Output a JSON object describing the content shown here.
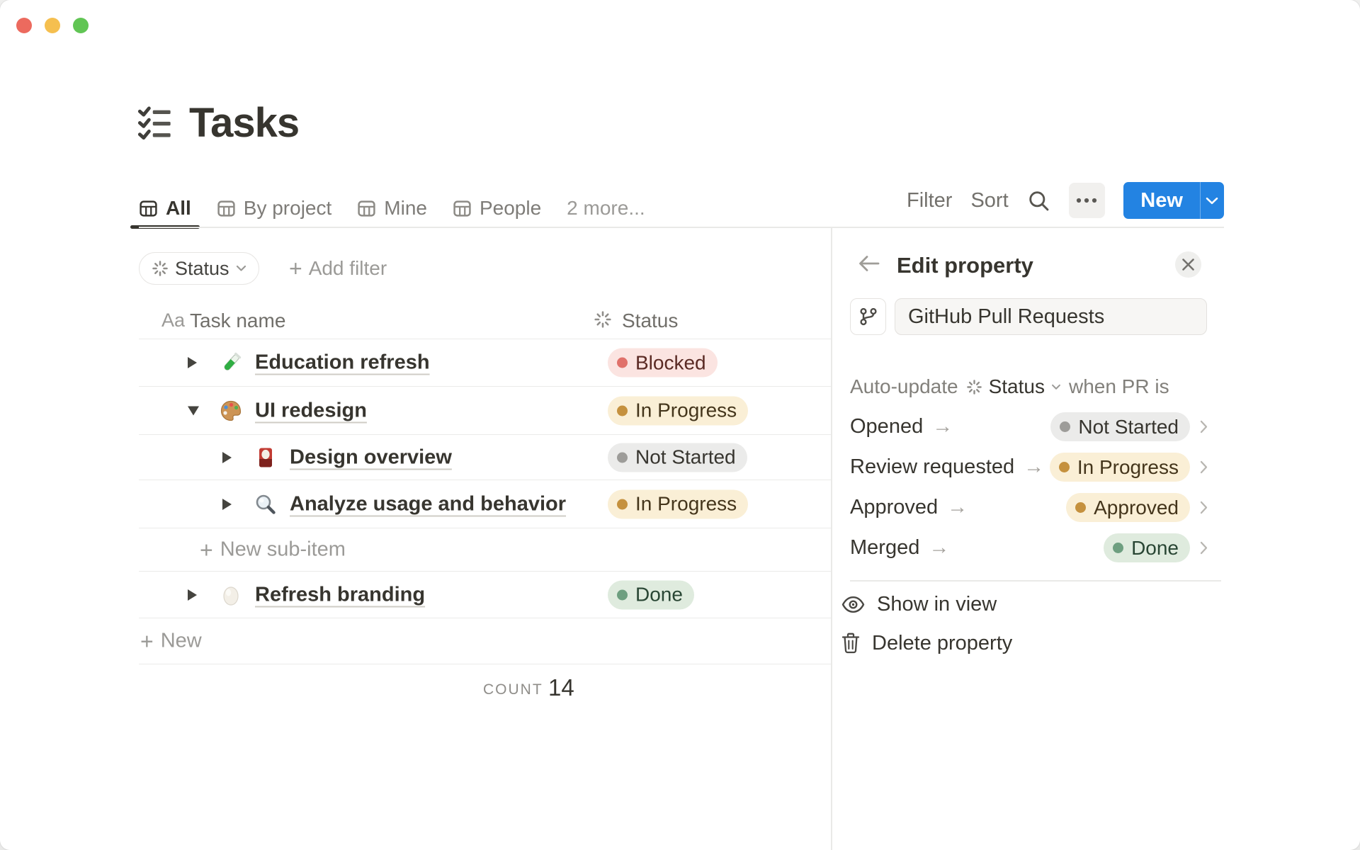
{
  "window": {
    "traffic_lights": {
      "close": "#EC6A5E",
      "minimize": "#F5BF4F",
      "zoom": "#61C554"
    }
  },
  "page": {
    "title": "Tasks"
  },
  "tabs": {
    "items": [
      {
        "label": "All"
      },
      {
        "label": "By project"
      },
      {
        "label": "Mine"
      },
      {
        "label": "People"
      }
    ],
    "active": "All",
    "more_label": "2 more..."
  },
  "toolbar": {
    "filter": "Filter",
    "sort": "Sort",
    "new_label": "New"
  },
  "filter_bar": {
    "status_filter": "Status",
    "add_filter": "Add filter"
  },
  "table": {
    "header": {
      "name_icon": "Aa",
      "name": "Task name",
      "status": "Status"
    },
    "rows": [
      {
        "name": "Education refresh",
        "status": "Blocked",
        "emoji": "test-tube",
        "level": 0,
        "state": "collapsed"
      },
      {
        "name": "UI redesign",
        "status": "In Progress",
        "emoji": "palette",
        "level": 0,
        "state": "expanded"
      },
      {
        "name": "Design overview",
        "status": "Not Started",
        "emoji": "flower-card",
        "level": 1,
        "state": "collapsed"
      },
      {
        "name": "Analyze usage and behavior",
        "status": "In Progress",
        "emoji": "magnifier",
        "level": 1,
        "state": "collapsed"
      },
      {
        "label": "New sub-item"
      },
      {
        "name": "Refresh branding",
        "status": "Done",
        "emoji": "egg",
        "level": 0,
        "state": "collapsed"
      },
      {
        "label": "New"
      }
    ],
    "footer": {
      "count_label": "COUNT",
      "count_value": "14"
    }
  },
  "panel": {
    "title": "Edit property",
    "property_name": "GitHub Pull Requests",
    "auto_update": {
      "prefix": "Auto-update",
      "property": "Status",
      "suffix": "when PR is"
    },
    "mappings": [
      {
        "event": "Opened",
        "status": "Not Started"
      },
      {
        "event": "Review requested",
        "status": "In Progress"
      },
      {
        "event": "Approved",
        "status": "Approved"
      },
      {
        "event": "Merged",
        "status": "Done"
      }
    ],
    "actions": {
      "show": "Show in view",
      "delete": "Delete property"
    }
  },
  "colors": {
    "accent_blue": "#2383E2",
    "text": "#37352F",
    "muted_text": "#787774",
    "status_gray": {
      "bg": "#EBEBEA",
      "dot": "#9D9C99",
      "text": "#37352F"
    },
    "status_yellow": {
      "bg": "#FAEFD6",
      "dot": "#C5913E",
      "text": "#44351B"
    },
    "status_red": {
      "bg": "#FBE4E1",
      "dot": "#E0716A",
      "text": "#5A2A24"
    },
    "status_green": {
      "bg": "#DFEBDE",
      "dot": "#6E9F80",
      "text": "#294634"
    }
  }
}
